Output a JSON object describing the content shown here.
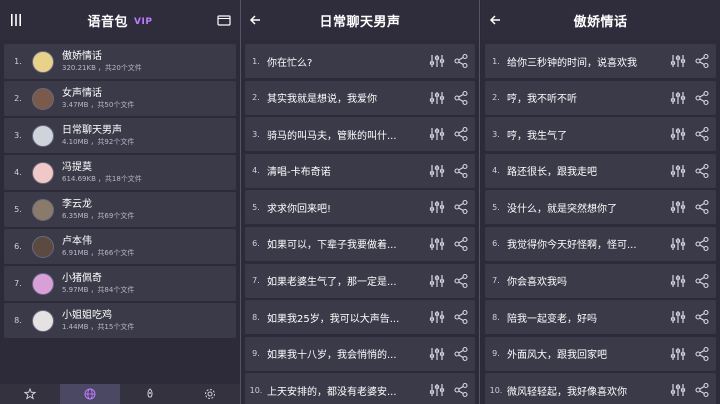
{
  "pane1": {
    "title": "语音包",
    "vip_badge": "VIP",
    "items": [
      {
        "index": "1.",
        "name": "傲娇情话",
        "size": "320.21KB",
        "count": "，共20个文件",
        "color": "#e8d28a"
      },
      {
        "index": "2.",
        "name": "女声情话",
        "size": "3.47MB",
        "count": "，共50个文件",
        "color": "#7a5a4a"
      },
      {
        "index": "3.",
        "name": "日常聊天男声",
        "size": "4.10MB",
        "count": "，共92个文件",
        "color": "#cfd3dc"
      },
      {
        "index": "4.",
        "name": "冯提莫",
        "size": "614.69KB",
        "count": "，共18个文件",
        "color": "#f0c8c8"
      },
      {
        "index": "5.",
        "name": "李云龙",
        "size": "6.35MB",
        "count": "，共69个文件",
        "color": "#8a7a6a"
      },
      {
        "index": "6.",
        "name": "卢本伟",
        "size": "6.91MB",
        "count": "，共66个文件",
        "color": "#5a4a40"
      },
      {
        "index": "7.",
        "name": "小猪佩奇",
        "size": "5.97MB",
        "count": "，共84个文件",
        "color": "#d9a0d8"
      },
      {
        "index": "8.",
        "name": "小姐姐吃鸡",
        "size": "1.44MB",
        "count": "，共15个文件",
        "color": "#e6e2e4"
      }
    ],
    "nav": [
      {
        "icon": "star-icon"
      },
      {
        "icon": "globe-icon"
      },
      {
        "icon": "rocket-icon"
      },
      {
        "icon": "settings-icon"
      }
    ]
  },
  "pane2": {
    "title": "日常聊天男声",
    "phrases": [
      {
        "index": "1.",
        "text": "你在忙么?"
      },
      {
        "index": "2.",
        "text": "其实我就是想说，我爱你"
      },
      {
        "index": "3.",
        "text": "骑马的叫马夫，管账的叫什..."
      },
      {
        "index": "4.",
        "text": "清唱-卡布奇诺"
      },
      {
        "index": "5.",
        "text": "求求你回来吧!"
      },
      {
        "index": "6.",
        "text": "如果可以，下辈子我要做着..."
      },
      {
        "index": "7.",
        "text": "如果老婆生气了，那一定是..."
      },
      {
        "index": "8.",
        "text": "如果我25岁，我可以大声告..."
      },
      {
        "index": "9.",
        "text": "如果我十八岁，我会悄悄的..."
      },
      {
        "index": "10.",
        "text": "上天安排的，都没有老婆安..."
      }
    ]
  },
  "pane3": {
    "title": "傲娇情话",
    "phrases": [
      {
        "index": "1.",
        "text": "给你三秒钟的时间，说喜欢我"
      },
      {
        "index": "2.",
        "text": "哼，我不听不听"
      },
      {
        "index": "3.",
        "text": "哼，我生气了"
      },
      {
        "index": "4.",
        "text": "路还很长，跟我走吧"
      },
      {
        "index": "5.",
        "text": "没什么，就是突然想你了"
      },
      {
        "index": "6.",
        "text": "我觉得你今天好怪啊，怪可..."
      },
      {
        "index": "7.",
        "text": "你会喜欢我吗"
      },
      {
        "index": "8.",
        "text": "陪我一起变老，好吗"
      },
      {
        "index": "9.",
        "text": "外面风大，跟我回家吧"
      },
      {
        "index": "10.",
        "text": "微风轻轻起，我好像喜欢你"
      }
    ]
  },
  "colors": {
    "background": "#2d2b39",
    "row": "#3b3a49",
    "accent": "#c07bff"
  }
}
